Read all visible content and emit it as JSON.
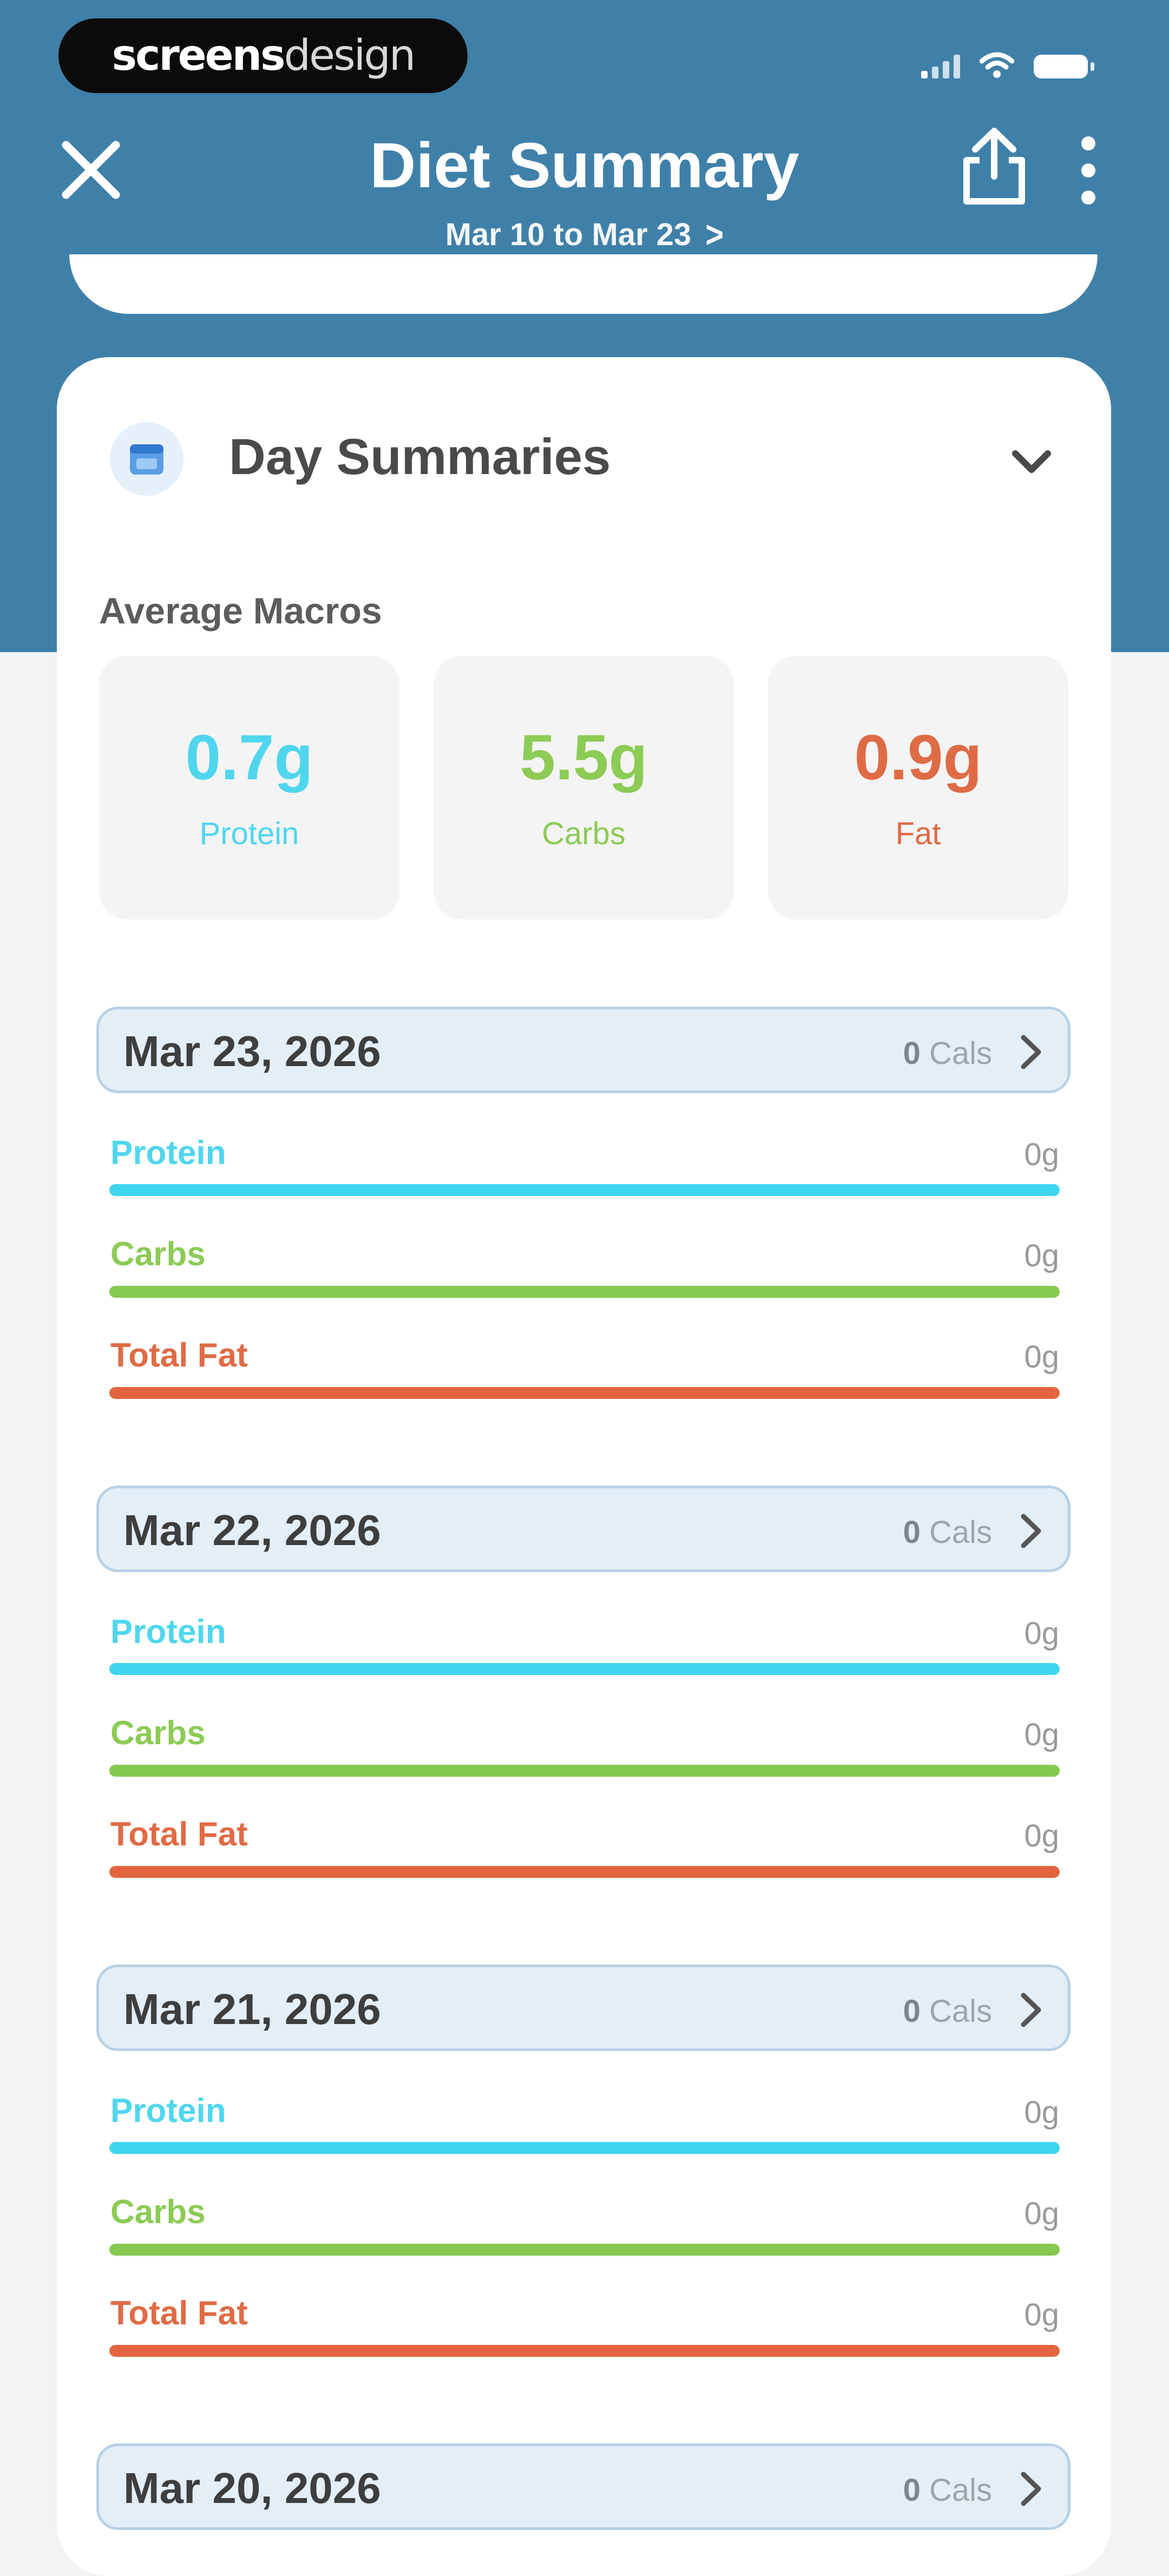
{
  "status_bar": {
    "brand_strong": "screens",
    "brand_light": "design"
  },
  "nav": {
    "title": "Diet Summary",
    "date_range": "Mar 10 to Mar 23",
    "date_range_chevron": ">"
  },
  "section": {
    "title": "Day Summaries",
    "icon": "calendar-icon",
    "average_label": "Average Macros"
  },
  "average_macros": [
    {
      "value": "0.7g",
      "label": "Protein",
      "color": "#4fd6ee"
    },
    {
      "value": "5.5g",
      "label": "Carbs",
      "color": "#8ccb55"
    },
    {
      "value": "0.9g",
      "label": "Fat",
      "color": "#df6b45"
    }
  ],
  "days": [
    {
      "date": "Mar 23, 2026",
      "cals_value": "0",
      "cals_unit": "Cals",
      "macros": [
        {
          "label": "Protein",
          "amount": "0g"
        },
        {
          "label": "Carbs",
          "amount": "0g"
        },
        {
          "label": "Total Fat",
          "amount": "0g"
        }
      ]
    },
    {
      "date": "Mar 22, 2026",
      "cals_value": "0",
      "cals_unit": "Cals",
      "macros": [
        {
          "label": "Protein",
          "amount": "0g"
        },
        {
          "label": "Carbs",
          "amount": "0g"
        },
        {
          "label": "Total Fat",
          "amount": "0g"
        }
      ]
    },
    {
      "date": "Mar 21, 2026",
      "cals_value": "0",
      "cals_unit": "Cals",
      "macros": [
        {
          "label": "Protein",
          "amount": "0g"
        },
        {
          "label": "Carbs",
          "amount": "0g"
        },
        {
          "label": "Total Fat",
          "amount": "0g"
        }
      ]
    },
    {
      "date": "Mar 20, 2026",
      "cals_value": "0",
      "cals_unit": "Cals"
    }
  ],
  "colors": {
    "header": "#3f80a9",
    "protein": "#3ed6ee",
    "carbs": "#85c94e",
    "fat": "#e3653f",
    "day_header_bg": "#e4eef7"
  }
}
